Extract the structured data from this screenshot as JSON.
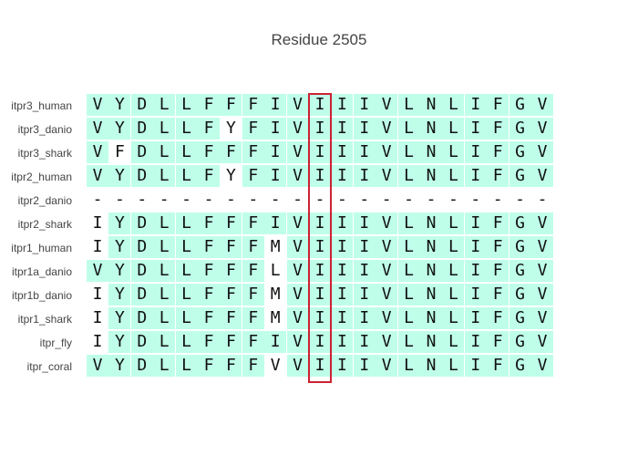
{
  "title": "Residue 2505",
  "colors": {
    "match": "#bfffea",
    "mismatch": "#ffffff",
    "highlight": "#cc2233"
  },
  "rows": [
    {
      "label": "itpr3_human",
      "seq": "VYDLLFFFIVIIIVLNLIFGV"
    },
    {
      "label": "itpr3_danio",
      "seq": "VYDLLFYFIVIIIVLNLIFGV"
    },
    {
      "label": "itpr3_shark",
      "seq": "VFDLLFFFIVIIIVLNLIFGV"
    },
    {
      "label": "itpr2_human",
      "seq": "VYDLLFYFIVIIIVLNLIFGV"
    },
    {
      "label": "itpr2_danio",
      "seq": "---------------------"
    },
    {
      "label": "itpr2_shark",
      "seq": "IYDLLFFFIVIIIVLNLIFGV"
    },
    {
      "label": "itpr1_human",
      "seq": "IYDLLFFFMVIIIVLNLIFGV"
    },
    {
      "label": "itpr1a_danio",
      "seq": "VYDLLFFFLVIIIVLNLIFGV"
    },
    {
      "label": "itpr1b_danio",
      "seq": "IYDLLFFFMVIIIVLNLIFGV"
    },
    {
      "label": "itpr1_shark",
      "seq": "IYDLLFFFMVIIIVLNLIFGV"
    },
    {
      "label": "itpr_fly",
      "seq": "IYDLLFFFIVIIIVLNLIFGV"
    },
    {
      "label": "itpr_coral",
      "seq": "VYDLLFFFVVIIIVLNLIFGV"
    }
  ]
}
